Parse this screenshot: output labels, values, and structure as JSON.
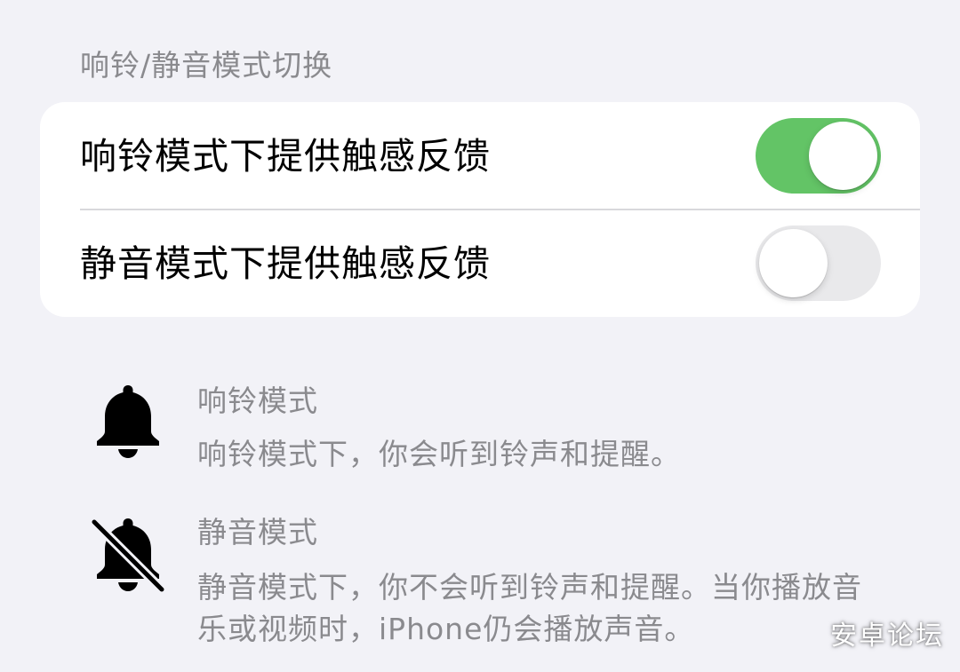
{
  "section": {
    "header": "响铃/静音模式切换"
  },
  "settings": [
    {
      "label": "响铃模式下提供触感反馈",
      "toggle_on": true
    },
    {
      "label": "静音模式下提供触感反馈",
      "toggle_on": false
    }
  ],
  "modes": {
    "ring": {
      "title": "响铃模式",
      "description": "响铃模式下，你会听到铃声和提醒。",
      "icon": "bell-icon"
    },
    "silent": {
      "title": "静音模式",
      "description": "静音模式下，你不会听到铃声和提醒。当你播放音乐或视频时，iPhone仍会播放声音。",
      "icon": "bell-slash-icon"
    }
  },
  "watermark": "安卓论坛",
  "colors": {
    "background": "#f2f2f7",
    "card": "#ffffff",
    "toggle_on": "#63c466",
    "toggle_off": "#e9e9eb",
    "secondary_text": "#8a8a8e"
  }
}
